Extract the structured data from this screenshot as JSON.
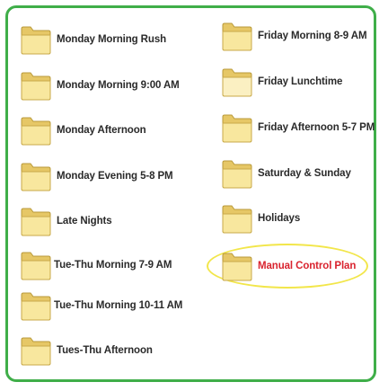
{
  "folders_left": [
    {
      "label": "Monday Morning Rush"
    },
    {
      "label": "Monday Morning 9:00 AM"
    },
    {
      "label": "Monday Afternoon"
    },
    {
      "label": "Monday Evening 5-8 PM"
    },
    {
      "label": "Late Nights"
    },
    {
      "label": "Tue-Thu Morning 7-9 AM"
    },
    {
      "label": "Tue-Thu Morning 10-11 AM"
    },
    {
      "label": "Tues-Thu Afternoon"
    }
  ],
  "folders_right": [
    {
      "label": "Friday Morning 8-9 AM"
    },
    {
      "label": "Friday Lunchtime"
    },
    {
      "label": "Friday Afternoon 5-7 PM"
    },
    {
      "label": "Saturday & Sunday"
    },
    {
      "label": "Holidays"
    },
    {
      "label": "Manual Control Plan"
    }
  ],
  "colors": {
    "frame_border": "#3fae49",
    "highlight_text": "#d9232e",
    "highlight_ellipse": "#f2e64a",
    "folder_fill": "#f6e08a"
  },
  "icon": "folder-icon"
}
